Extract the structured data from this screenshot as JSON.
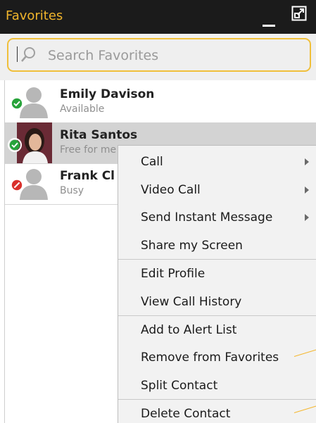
{
  "panel": {
    "title": "Favorites"
  },
  "search": {
    "placeholder": "Search Favorites"
  },
  "contacts": [
    {
      "name": "Emily Davison",
      "status": "Available",
      "presence": "available"
    },
    {
      "name": "Rita Santos",
      "status": "Free for me",
      "presence": "available"
    },
    {
      "name": "Frank Cl",
      "status": "Busy",
      "presence": "busy"
    }
  ],
  "menu": {
    "items": [
      {
        "label": "Call",
        "submenu": true
      },
      {
        "label": "Video Call",
        "submenu": true
      },
      {
        "label": "Send Instant Message",
        "submenu": true
      },
      {
        "label": "Share my Screen",
        "submenu": false
      },
      {
        "label": "Edit Profile",
        "submenu": false
      },
      {
        "label": "View Call History",
        "submenu": false
      },
      {
        "label": "Add to Alert List",
        "submenu": false
      },
      {
        "label": "Remove from Favorites",
        "submenu": false
      },
      {
        "label": "Split Contact",
        "submenu": false
      },
      {
        "label": "Delete Contact",
        "submenu": false
      }
    ]
  },
  "colors": {
    "accent": "#f1b52c",
    "available": "#27a33a",
    "busy": "#d9302b",
    "titlebar": "#1b1b1b"
  }
}
